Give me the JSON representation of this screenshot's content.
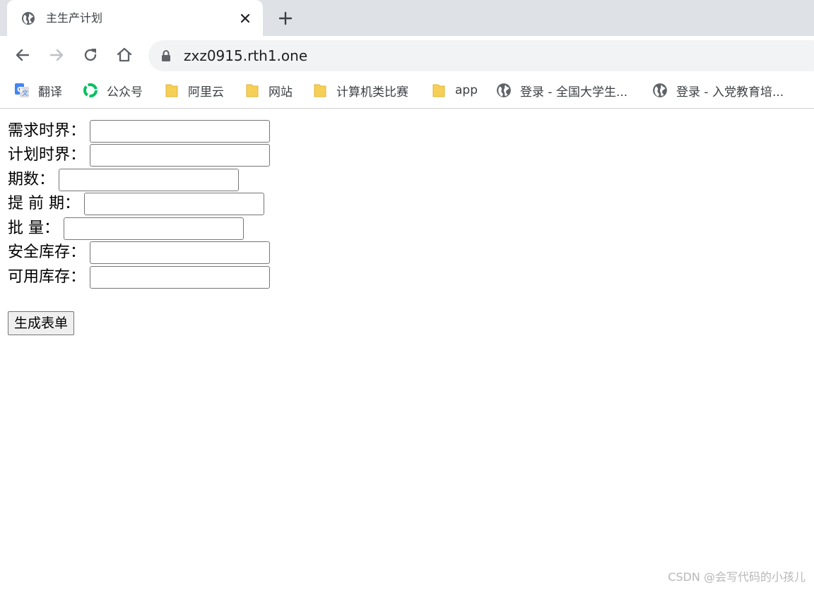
{
  "browser": {
    "tab": {
      "title": "主生产计划",
      "icon": "globe-icon"
    },
    "url": "zxz0915.rth1.one",
    "bookmarks": [
      {
        "label": "翻译",
        "icon": "google-translate-icon"
      },
      {
        "label": "公众号",
        "icon": "wechat-channel-icon"
      },
      {
        "label": "阿里云",
        "icon": "folder-icon"
      },
      {
        "label": "网站",
        "icon": "folder-icon"
      },
      {
        "label": "计算机类比赛",
        "icon": "folder-icon"
      },
      {
        "label": "app",
        "icon": "folder-icon"
      },
      {
        "label": "登录 - 全国大学生...",
        "icon": "globe-icon"
      },
      {
        "label": "登录 - 入党教育培...",
        "icon": "globe-icon"
      }
    ]
  },
  "form": {
    "fields": [
      {
        "label": "需求时界：",
        "value": ""
      },
      {
        "label": "计划时界：",
        "value": ""
      },
      {
        "label": "期数：",
        "value": ""
      },
      {
        "label": "提 前 期：",
        "value": ""
      },
      {
        "label": "批 量：",
        "value": ""
      },
      {
        "label": "安全库存：",
        "value": ""
      },
      {
        "label": "可用库存：",
        "value": ""
      }
    ],
    "submit_label": "生成表单"
  },
  "watermark": "CSDN @会写代码的小孩儿",
  "colors": {
    "tabstrip_bg": "#dee1e6",
    "omnibox_bg": "#f1f3f4",
    "folder_yellow": "#f6cf57",
    "wechat_green": "#07c160"
  }
}
